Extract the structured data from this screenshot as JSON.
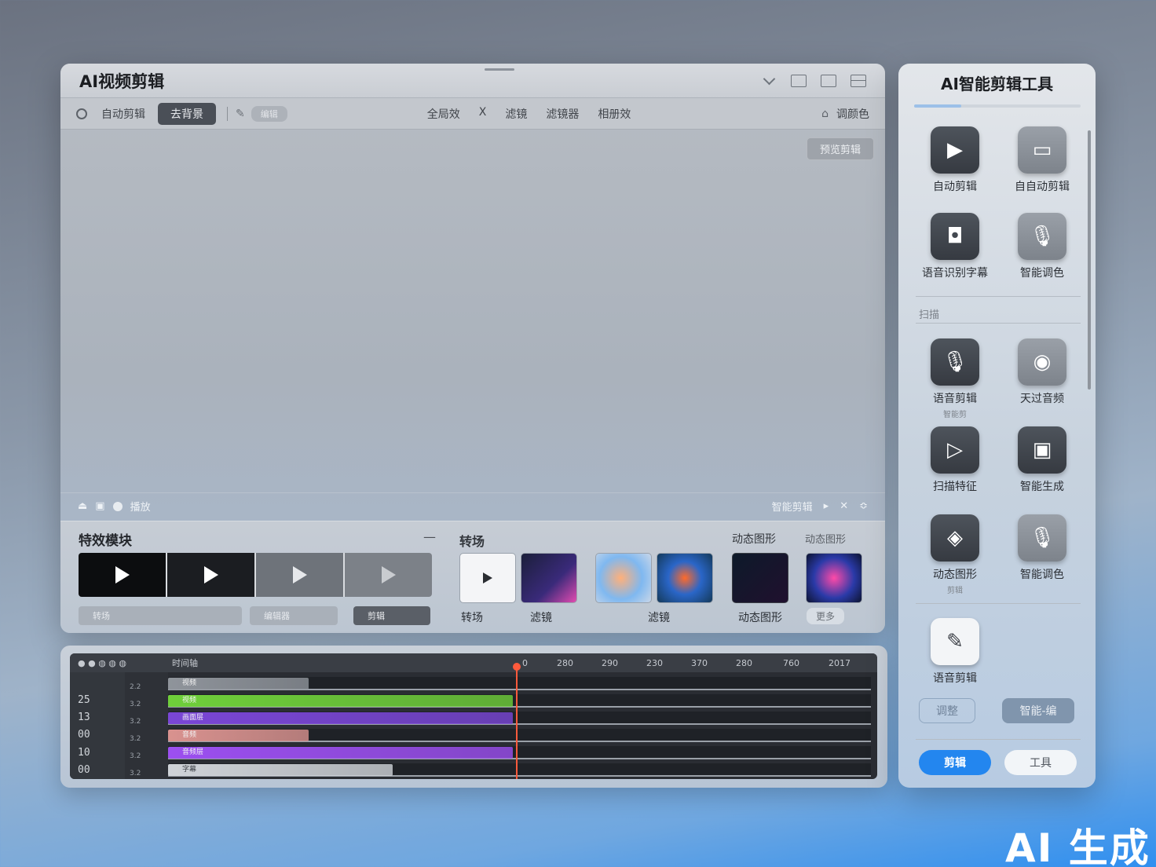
{
  "editor": {
    "title": "AI视频剪辑",
    "toolbar": {
      "left_item": "自动剪辑",
      "active_button": "去背景",
      "pill": "编辑",
      "center_items": [
        "全局效",
        "X",
        "滤镜",
        "滤镜器",
        "相册效"
      ],
      "right_item": "调颜色"
    },
    "preview": {
      "badge": "预览剪辑",
      "status_left": "播放",
      "status_right": "智能剪辑"
    },
    "effects": {
      "title": "特效模块",
      "chips": [
        "转场",
        "编辑器",
        "剪辑",
        "剪辑"
      ],
      "transitions_title": "转场",
      "motion_title": "动态图形",
      "motion_sub": "动态图形",
      "labels": [
        "转场",
        "滤镜",
        "滤镜",
        "动态图形",
        "更多"
      ]
    }
  },
  "timeline": {
    "header": "时间轴",
    "ruler": [
      "0",
      "280",
      "290",
      "230",
      "370",
      "280",
      "760",
      "2017"
    ],
    "times": [
      "25",
      "13",
      "00",
      "10",
      "00"
    ],
    "row_names": [
      "2.2",
      "3.2",
      "3.2",
      "3.2",
      "3.2",
      "3.2"
    ],
    "clips": [
      {
        "label": "视频",
        "color": "#8f949b",
        "fraction": 0.2
      },
      {
        "label": "视频",
        "color": "#6fcf3a",
        "fraction": 0.49
      },
      {
        "label": "画面层",
        "color": "#7a46d6",
        "fraction": 0.49
      },
      {
        "label": "音频",
        "color": "#d9928f",
        "fraction": 0.2
      },
      {
        "label": "音频层",
        "color": "#9c4ff0",
        "fraction": 0.49
      },
      {
        "label": "字幕",
        "color": "#cfd3d8",
        "fraction": 0.32
      }
    ]
  },
  "side": {
    "title": "AI智能剪辑工具",
    "section": "扫描",
    "tools": [
      {
        "label": "自动剪辑",
        "icon": "auto-edit-icon",
        "glyph": "▶",
        "style": "dark"
      },
      {
        "label": "自自动剪辑",
        "icon": "monitor-icon",
        "glyph": "▭",
        "style": "gray"
      },
      {
        "label": "语音识别字幕",
        "icon": "screen-subtitle-icon",
        "glyph": "◘",
        "style": "dark"
      },
      {
        "label": "智能调色",
        "icon": "microphone-icon",
        "glyph": "🎙",
        "style": "gray"
      },
      {
        "label": "语音剪辑",
        "sub": "智能剪",
        "icon": "microphone-icon",
        "glyph": "🎙",
        "style": "dark"
      },
      {
        "label": "天过音频",
        "icon": "eye-icon",
        "glyph": "◉",
        "style": "gray"
      },
      {
        "label": "扫描特征",
        "icon": "play-frame-icon",
        "glyph": "▷",
        "style": "dark"
      },
      {
        "label": "智能生成",
        "icon": "edit-box-icon",
        "glyph": "▣",
        "style": "dark"
      },
      {
        "label": "动态图形",
        "sub": "剪辑",
        "icon": "diamond-play-icon",
        "glyph": "◈",
        "style": "dark"
      },
      {
        "label": "智能调色",
        "icon": "microphone-icon",
        "glyph": "🎙",
        "style": "gray"
      },
      {
        "label": "语音剪辑",
        "icon": "chat-edit-icon",
        "glyph": "✎",
        "style": "light"
      }
    ],
    "outline_btn_left": "调整",
    "outline_btn_right": "智能-编",
    "primary_btn": "剪辑",
    "secondary_btn": "工具"
  },
  "watermark": "AI 生成"
}
